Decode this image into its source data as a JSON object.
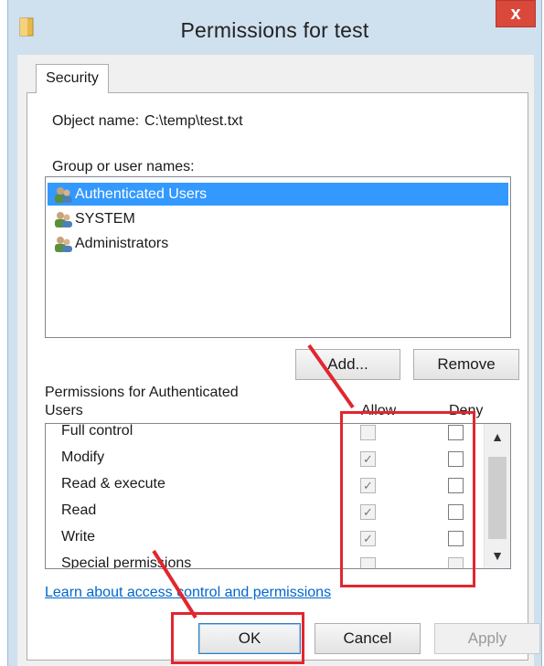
{
  "window": {
    "title": "Permissions for test",
    "close_label": "x"
  },
  "tabs": [
    {
      "label": "Security"
    }
  ],
  "object": {
    "label": "Object name:",
    "value": "C:\\temp\\test.txt"
  },
  "group_list": {
    "label": "Group or user names:",
    "items": [
      {
        "label": "Authenticated Users",
        "selected": true
      },
      {
        "label": "SYSTEM",
        "selected": false
      },
      {
        "label": "Administrators",
        "selected": false
      }
    ]
  },
  "buttons": {
    "add": "Add...",
    "remove": "Remove",
    "ok": "OK",
    "cancel": "Cancel",
    "apply": "Apply"
  },
  "permissions": {
    "label_line1": "Permissions for Authenticated",
    "label_line2": "Users",
    "allow_header": "Allow",
    "deny_header": "Deny",
    "rows": [
      {
        "name": "Full control",
        "allow": false,
        "deny": false
      },
      {
        "name": "Modify",
        "allow": true,
        "deny": false
      },
      {
        "name": "Read & execute",
        "allow": true,
        "deny": false
      },
      {
        "name": "Read",
        "allow": true,
        "deny": false
      },
      {
        "name": "Write",
        "allow": true,
        "deny": false
      },
      {
        "name": "Special permissions",
        "allow": false,
        "deny": false
      }
    ]
  },
  "help_link": "Learn about access control and permissions",
  "colors": {
    "selection": "#3399ff",
    "annotation": "#e2262e",
    "link": "#0066cc"
  }
}
